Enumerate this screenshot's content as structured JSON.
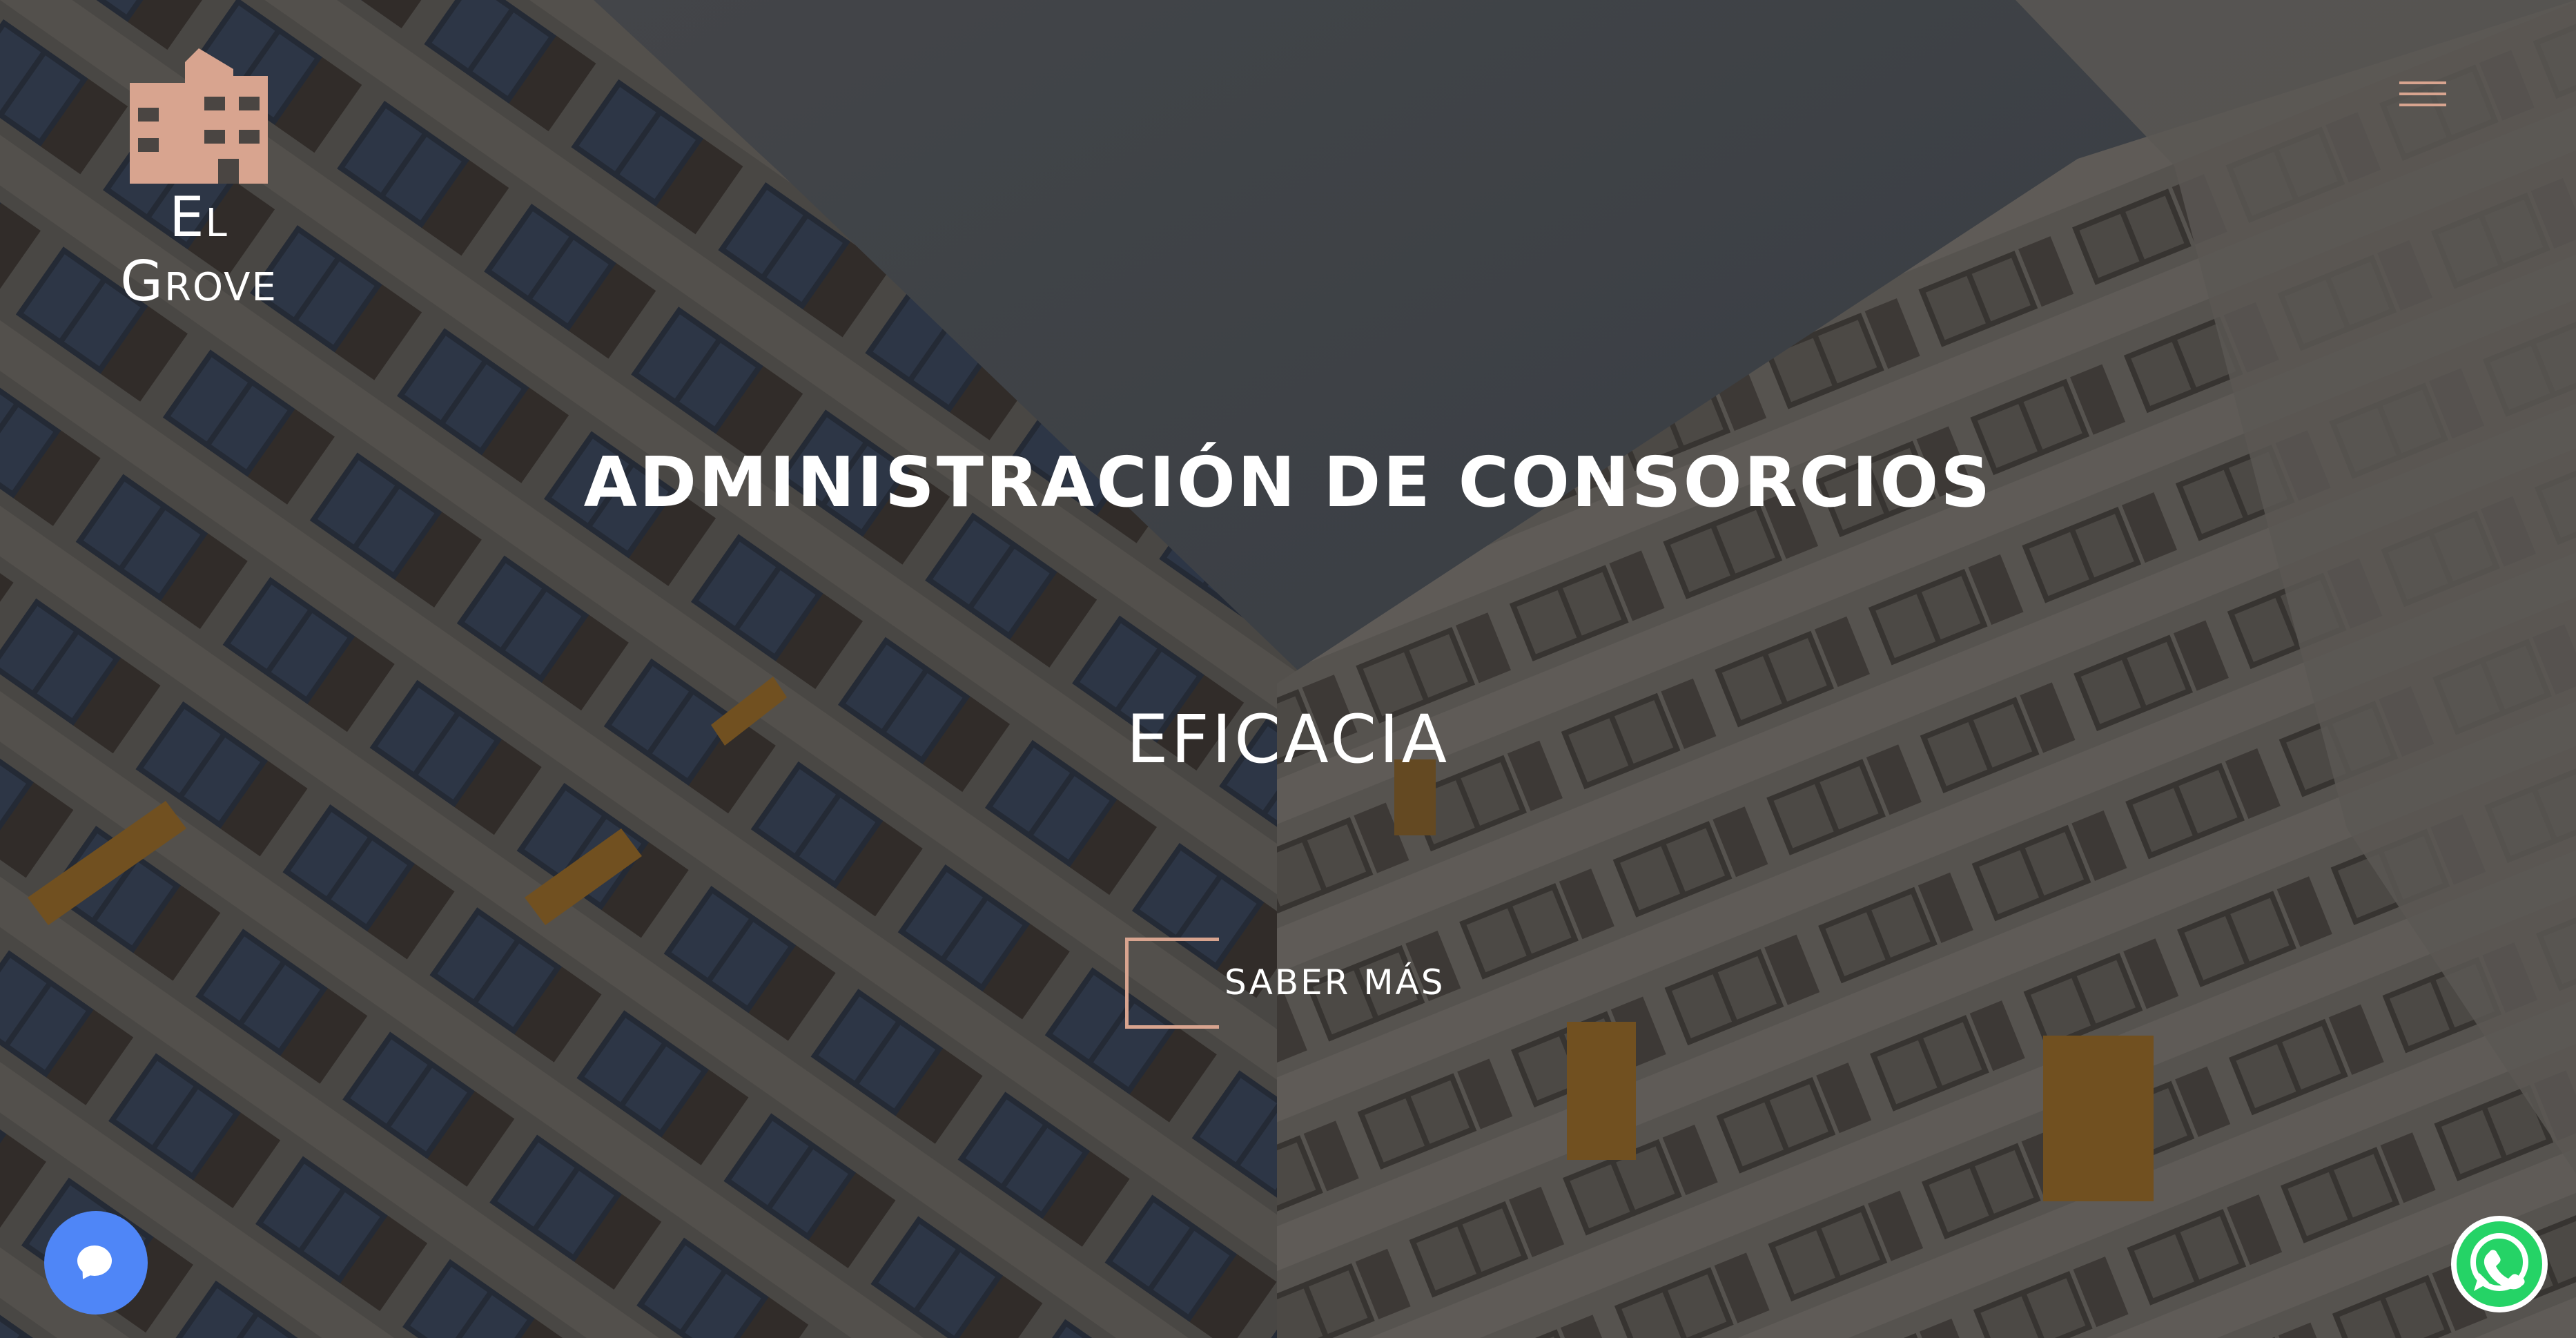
{
  "brand": {
    "name": "El Grove",
    "logo_icon": "building-icon",
    "logo_color": "#d8a48f"
  },
  "nav": {
    "menu_icon": "hamburger-menu-icon"
  },
  "hero": {
    "headline": "ADMINISTRACIÓN DE CONSORCIOS",
    "tagline": "EFICACIA",
    "cta_label": "SABER MÁS",
    "accent_color": "#d8a48f",
    "background": "apartment-building-photo"
  },
  "widgets": {
    "chat_icon": "chat-bubble-icon",
    "chat_color": "#4f86f7",
    "whatsapp_icon": "whatsapp-icon",
    "whatsapp_color": "#25d366"
  }
}
